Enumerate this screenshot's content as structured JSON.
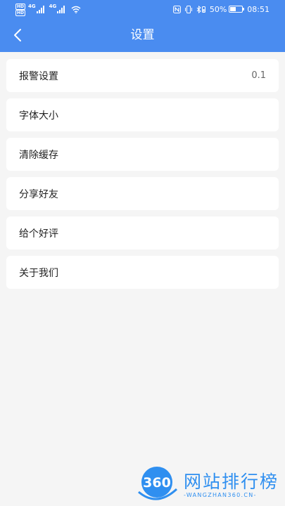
{
  "status_bar": {
    "hd_badges": [
      "HD",
      "HD"
    ],
    "network_labels": [
      "4G",
      "4G"
    ],
    "battery_percent": "50%",
    "battery_level": 0.5,
    "time": "08:51"
  },
  "header": {
    "title": "设置",
    "back_icon": "chevron-left-icon",
    "color": "#4a8cf0"
  },
  "menu": {
    "items": [
      {
        "label": "报警设置",
        "value": "0.1"
      },
      {
        "label": "字体大小"
      },
      {
        "label": "清除缓存"
      },
      {
        "label": "分享好友"
      },
      {
        "label": "给个好评"
      },
      {
        "label": "关于我们"
      }
    ]
  },
  "watermark": {
    "logo_text": "360",
    "name": "网站排行榜",
    "url": "-WANGZHAN360.CN-",
    "color": "#2f8ff0"
  }
}
